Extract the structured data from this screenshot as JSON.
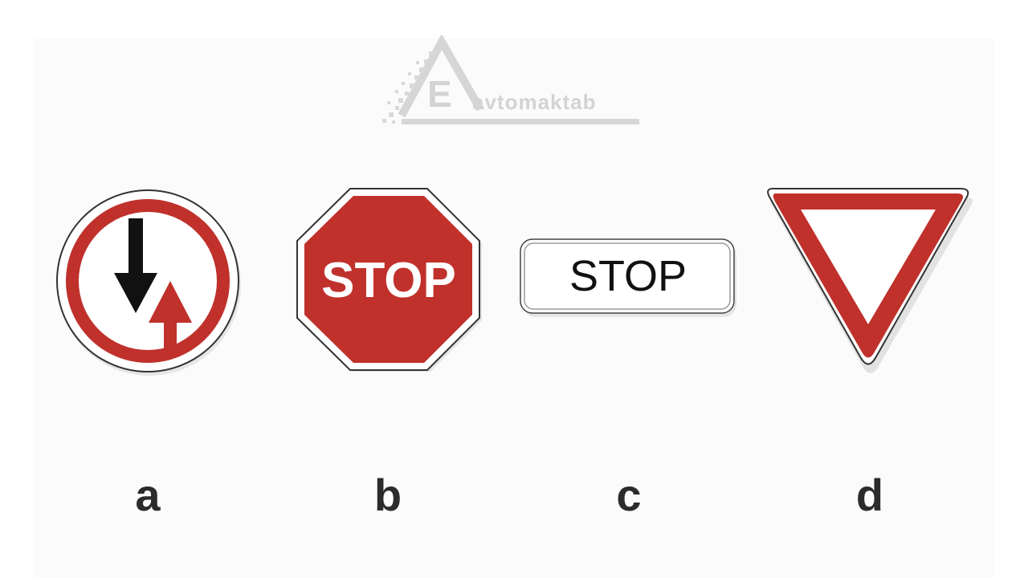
{
  "watermark": {
    "letter": "E",
    "text": "avtomaktab",
    "color": "#d3d3d3"
  },
  "signs": [
    {
      "label": "a",
      "icon": "priority-oncoming-traffic-icon"
    },
    {
      "label": "b",
      "icon": "stop-octagon-icon",
      "text": "STOP"
    },
    {
      "label": "c",
      "icon": "stop-plate-icon",
      "text": "STOP"
    },
    {
      "label": "d",
      "icon": "yield-triangle-icon"
    }
  ],
  "colors": {
    "sign_red": "#c0312c",
    "sign_black": "#111111",
    "sign_white": "#ffffff",
    "label_text": "#2b2b2b"
  }
}
